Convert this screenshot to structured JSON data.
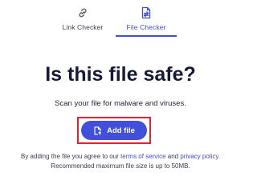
{
  "tabs": [
    {
      "label": "Link Checker",
      "icon": "link-icon",
      "active": false
    },
    {
      "label": "File Checker",
      "icon": "file-transfer-icon",
      "active": true
    }
  ],
  "heading": "Is this file safe?",
  "subtitle": "Scan your file for malware and viruses.",
  "add_button": {
    "label": "Add file",
    "icon": "file-upload-icon"
  },
  "terms": {
    "prefix": "By adding the file you agree to our ",
    "terms_link": "terms of service",
    "middle": " and ",
    "privacy_link": "privacy policy",
    "suffix": "."
  },
  "max_size_note": "Recommended maximum file size is up to 50MB.",
  "colors": {
    "accent": "#3f4ed8",
    "button": "#4150db",
    "highlight": "#e0242f",
    "heading": "#161a36"
  }
}
